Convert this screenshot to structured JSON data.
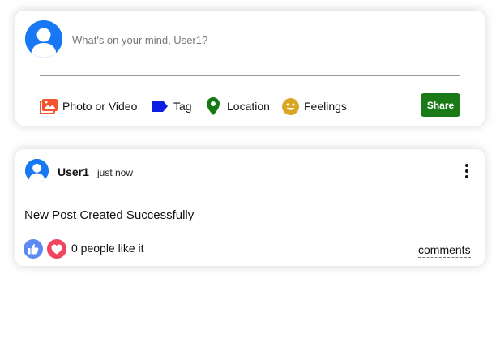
{
  "composer": {
    "placeholder": "What's on your mind, User1?",
    "options": [
      {
        "label": "Photo or Video",
        "icon": "photo-icon",
        "color": "#f3532d"
      },
      {
        "label": "Tag",
        "icon": "tag-icon",
        "color": "#0a1ee6"
      },
      {
        "label": "Location",
        "icon": "location-pin-icon",
        "color": "#157a14"
      },
      {
        "label": "Feelings",
        "icon": "smiley-icon",
        "color": "#d9a524"
      }
    ],
    "share_label": "Share",
    "share_color": "#1a7a18"
  },
  "post": {
    "username": "User1",
    "time": "just now",
    "text": "New Post Created Successfully",
    "like_text": "0 people like it",
    "comments_label": "comments",
    "like_color": "#5c8af2",
    "heart_color": "#f0445f"
  },
  "avatar_color": "#1877f2"
}
